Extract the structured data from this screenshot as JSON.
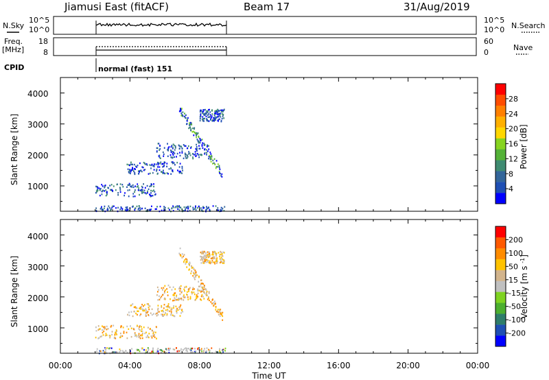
{
  "header": {
    "station": "Jiamusi East (fitACF)",
    "beam": "Beam 17",
    "date": "31/Aug/2019"
  },
  "params": {
    "nsky_label": "N.Sky",
    "nsearch_label": "N.Search",
    "freq_label_1": "Freq.",
    "freq_label_2": "[MHz]",
    "nave_label": "Nave",
    "cpid_label": "CPID",
    "cpid_value": "normal (fast) 151",
    "noise_ticks": [
      "10^5",
      "10^0"
    ],
    "freq_ticks": [
      "18",
      "8"
    ],
    "nave_ticks": [
      "60",
      "0"
    ]
  },
  "time_axis": {
    "xlabel": "Time UT",
    "ticks": [
      "00:00",
      "04:00",
      "08:00",
      "12:00",
      "16:00",
      "20:00",
      "00:00"
    ]
  },
  "colors": {
    "power": [
      "#0000ff",
      "#1f4fb4",
      "#33669a",
      "#3f8b71",
      "#54b238",
      "#87d420",
      "#ffd700",
      "#ffb000",
      "#ff8000",
      "#ff4d00",
      "#ff0000"
    ],
    "velocity": [
      "#0000ff",
      "#1f4fb4",
      "#2e7d6a",
      "#4caf2f",
      "#7fd321",
      "#c0c0c0",
      "#d2b48c",
      "#ffc300",
      "#ff8c00",
      "#ff5a00",
      "#ff0000"
    ],
    "ground": "#bdbdbd"
  },
  "chart_data": [
    {
      "id": "power",
      "type": "heatmap",
      "title": "",
      "xlabel": "",
      "ylabel": "Slant Range [km]",
      "x_range_hours": [
        0,
        24
      ],
      "ylim": [
        180,
        4500
      ],
      "yticks": [
        "1000",
        "2000",
        "3000",
        "4000"
      ],
      "colorbar": {
        "label": "Power [dB]",
        "range": [
          0,
          30
        ],
        "ticks": [
          "4",
          "8",
          "12",
          "16",
          "20",
          "24",
          "28"
        ]
      },
      "observation_window_hours": [
        2.0,
        9.5
      ],
      "echo_regions": [
        {
          "feature": "ground scatter band",
          "t": [
            2.0,
            9.5
          ],
          "range_km": [
            200,
            380
          ]
        },
        {
          "feature": "low band",
          "t": [
            2.0,
            5.5
          ],
          "range_km": [
            680,
            1100
          ]
        },
        {
          "feature": "mid band",
          "t": [
            3.8,
            7.0
          ],
          "range_km": [
            1400,
            1800
          ]
        },
        {
          "feature": "mid patch",
          "t": [
            5.5,
            8.5
          ],
          "range_km": [
            1900,
            2400
          ]
        },
        {
          "feature": "upper arc",
          "t": [
            6.8,
            9.3
          ],
          "range_km": [
            1400,
            3500
          ]
        },
        {
          "feature": "high patch",
          "t": [
            8.0,
            9.4
          ],
          "range_km": [
            3100,
            3500
          ]
        }
      ]
    },
    {
      "id": "velocity",
      "type": "heatmap",
      "title": "",
      "xlabel": "Time UT",
      "ylabel": "Slant Range [km]",
      "x_range_hours": [
        0,
        24
      ],
      "ylim": [
        180,
        4500
      ],
      "yticks": [
        "1000",
        "2000",
        "3000",
        "4000"
      ],
      "colorbar": {
        "label": "Velocity [m s^-1]",
        "range": [
          -250,
          250
        ],
        "ticks": [
          "200",
          "100",
          "50",
          "15",
          "-15",
          "-50",
          "-100",
          "-200"
        ]
      },
      "observation_window_hours": [
        2.0,
        9.5
      ]
    }
  ]
}
